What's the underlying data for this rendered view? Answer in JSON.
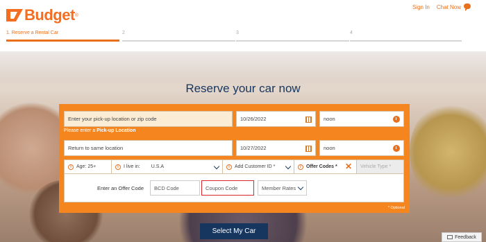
{
  "brand": {
    "name": "Budget",
    "trademark": "®",
    "color": "#f36e21"
  },
  "toplinks": {
    "signin": "Sign In",
    "chat": "Chat Now"
  },
  "steps": [
    {
      "label": "1. Reserve a Rental Car",
      "active": true
    },
    {
      "label": "2",
      "active": false
    },
    {
      "label": "3",
      "active": false
    },
    {
      "label": "4",
      "active": false
    }
  ],
  "hero": {
    "title": "Reserve your car now"
  },
  "form": {
    "pickup_placeholder": "Enter your pick-up location or zip code",
    "error_prefix": "Please enter a ",
    "error_strong": "Pick-up Location",
    "pickup_date": "10/26/2022",
    "pickup_time": "noon",
    "return_location": "Return to same location",
    "return_date": "10/27/2022",
    "return_time": "noon",
    "age_label": "Age:",
    "age_value": "25+",
    "live_label": "I live in:",
    "live_value": "U.S.A",
    "customer_id": "Add Customer ID *",
    "offer_codes": "Offer Codes *",
    "vehicle_type": "Vehicle Type *",
    "offer_panel_label": "Enter an Offer Code",
    "bcd_placeholder": "BCD Code",
    "coupon_placeholder": "Coupon Code",
    "member_rates": "Member Rates",
    "optional_note": "* Optional"
  },
  "submit_label": "Select My Car",
  "feedback_label": "Feedback",
  "colors": {
    "accent": "#f5861f",
    "navy": "#16365f",
    "highlight": "#d8242a"
  }
}
